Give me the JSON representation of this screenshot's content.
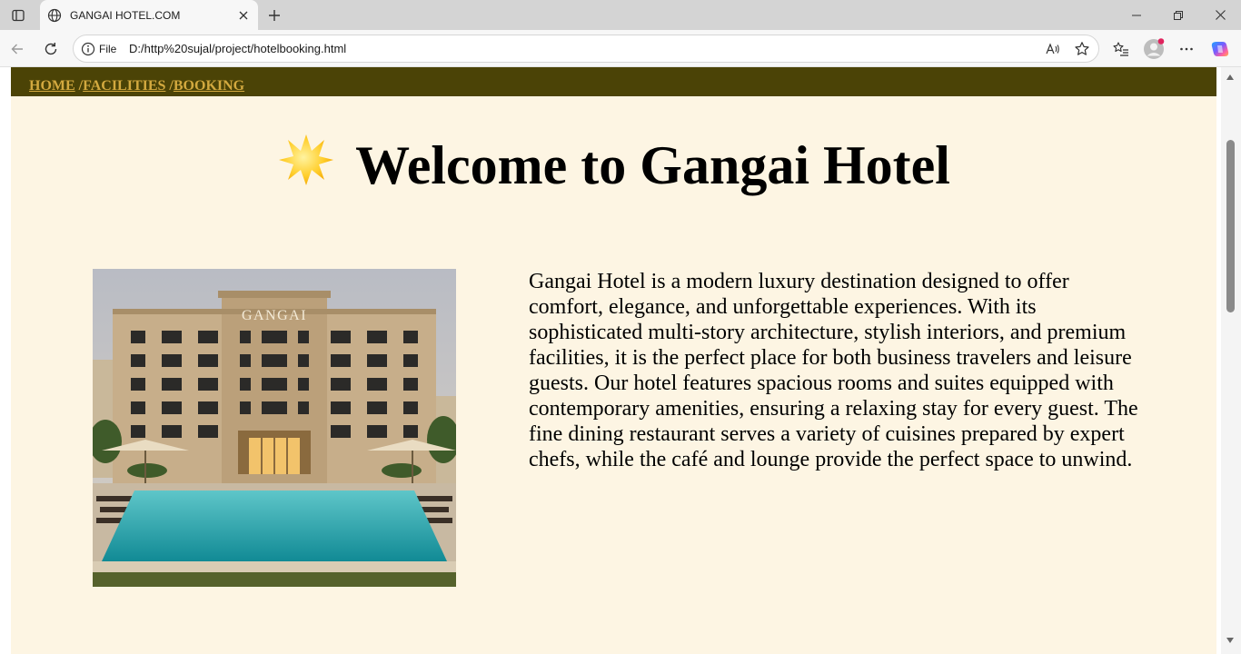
{
  "browser": {
    "tab_title": "GANGAI HOTEL.COM",
    "file_label": "File",
    "url": "D:/http%20sujal/project/hotelbooking.html",
    "icons": [
      "tab-actions-icon",
      "globe-icon",
      "close-icon",
      "new-tab-icon",
      "minimize-icon",
      "restore-icon",
      "window-close-icon",
      "back-icon",
      "refresh-icon",
      "info-icon",
      "read-aloud-icon",
      "favorite-star-icon",
      "favorites-icon",
      "profile-icon",
      "more-icon",
      "copilot-icon"
    ]
  },
  "page": {
    "nav": {
      "links": [
        "HOME",
        "FACILITIES",
        "BOOKING"
      ],
      "separator": "/"
    },
    "heading": "Welcome to Gangai Hotel",
    "heading_icon": "star-emoji-icon",
    "image_sign": "GANGAI",
    "about": "Gangai Hotel is a modern luxury destination designed to offer comfort, elegance, and unforgettable experiences. With its sophisticated multi-story architecture, stylish interiors, and premium facilities, it is the perfect place for both business travelers and leisure guests. Our hotel features spacious rooms and suites equipped with contemporary amenities, ensuring a relaxing stay for every guest. The fine dining restaurant serves a variety of cuisines prepared by expert chefs, while the café and lounge provide the perfect space to unwind."
  },
  "colors": {
    "navbar": "#4b4306",
    "nav_link": "#d3a93f",
    "page_bg": "#fdf5e3"
  }
}
